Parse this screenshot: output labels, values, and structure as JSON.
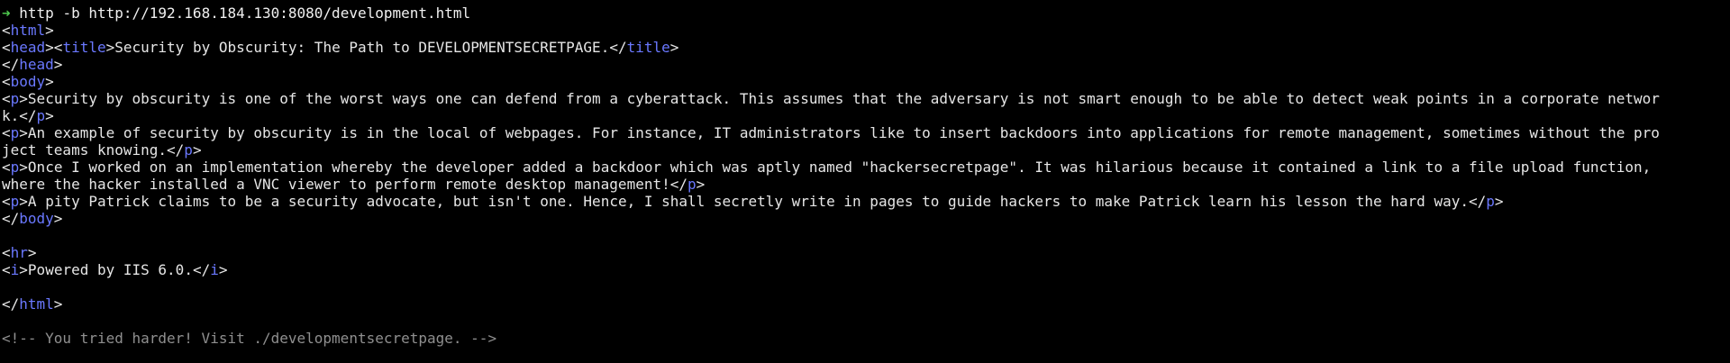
{
  "prompt": {
    "arrow": "➜",
    "command": " http -b http://192.168.184.130:8080/development.html"
  },
  "html": {
    "open_html": "<html>",
    "close_html": "</html>",
    "head_open": "<head>",
    "title_open": "<title>",
    "title_text": "Security by Obscurity: The Path to DEVELOPMENTSECRETPAGE.",
    "title_close": "</title>",
    "head_close": "</head>",
    "body_open": "<body>",
    "body_close": "</body>",
    "p_open": "<p>",
    "p_close": "</p>",
    "hr": "<hr>",
    "i_open": "<i>",
    "i_close": "</i>"
  },
  "paragraphs": {
    "p1_line1": "Security by obscurity is one of the worst ways one can defend from a cyberattack. This assumes that the adversary is not smart enough to be able to detect weak points in a corporate networ",
    "p1_line2": "k.",
    "p2_line1": "An example of security by obscurity is in the local of webpages. For instance, IT administrators like to insert backdoors into applications for remote management, sometimes without the pro",
    "p2_line2": "ject teams knowing.",
    "p3_line1": "Once I worked on an implementation whereby the developer added a backdoor which was aptly named \"hackersecretpage\". It was hilarious because it contained a link to a file upload function,",
    "p3_line2": "where the hacker installed a VNC viewer to perform remote desktop management!",
    "p4": "A pity Patrick claims to be a security advocate, but isn't one. Hence, I shall secretly write in pages to guide hackers to make Patrick learn his lesson the hard way."
  },
  "footer": {
    "powered_by": "Powered by IIS 6.0."
  },
  "comment": "<!-- You tried harder! Visit ./developmentsecretpage. -->",
  "colors": {
    "background": "#000000",
    "text": "#e6e6e6",
    "tag": "#6a78ff",
    "comment": "#8f8f8f",
    "prompt_arrow": "#4ec94e"
  }
}
